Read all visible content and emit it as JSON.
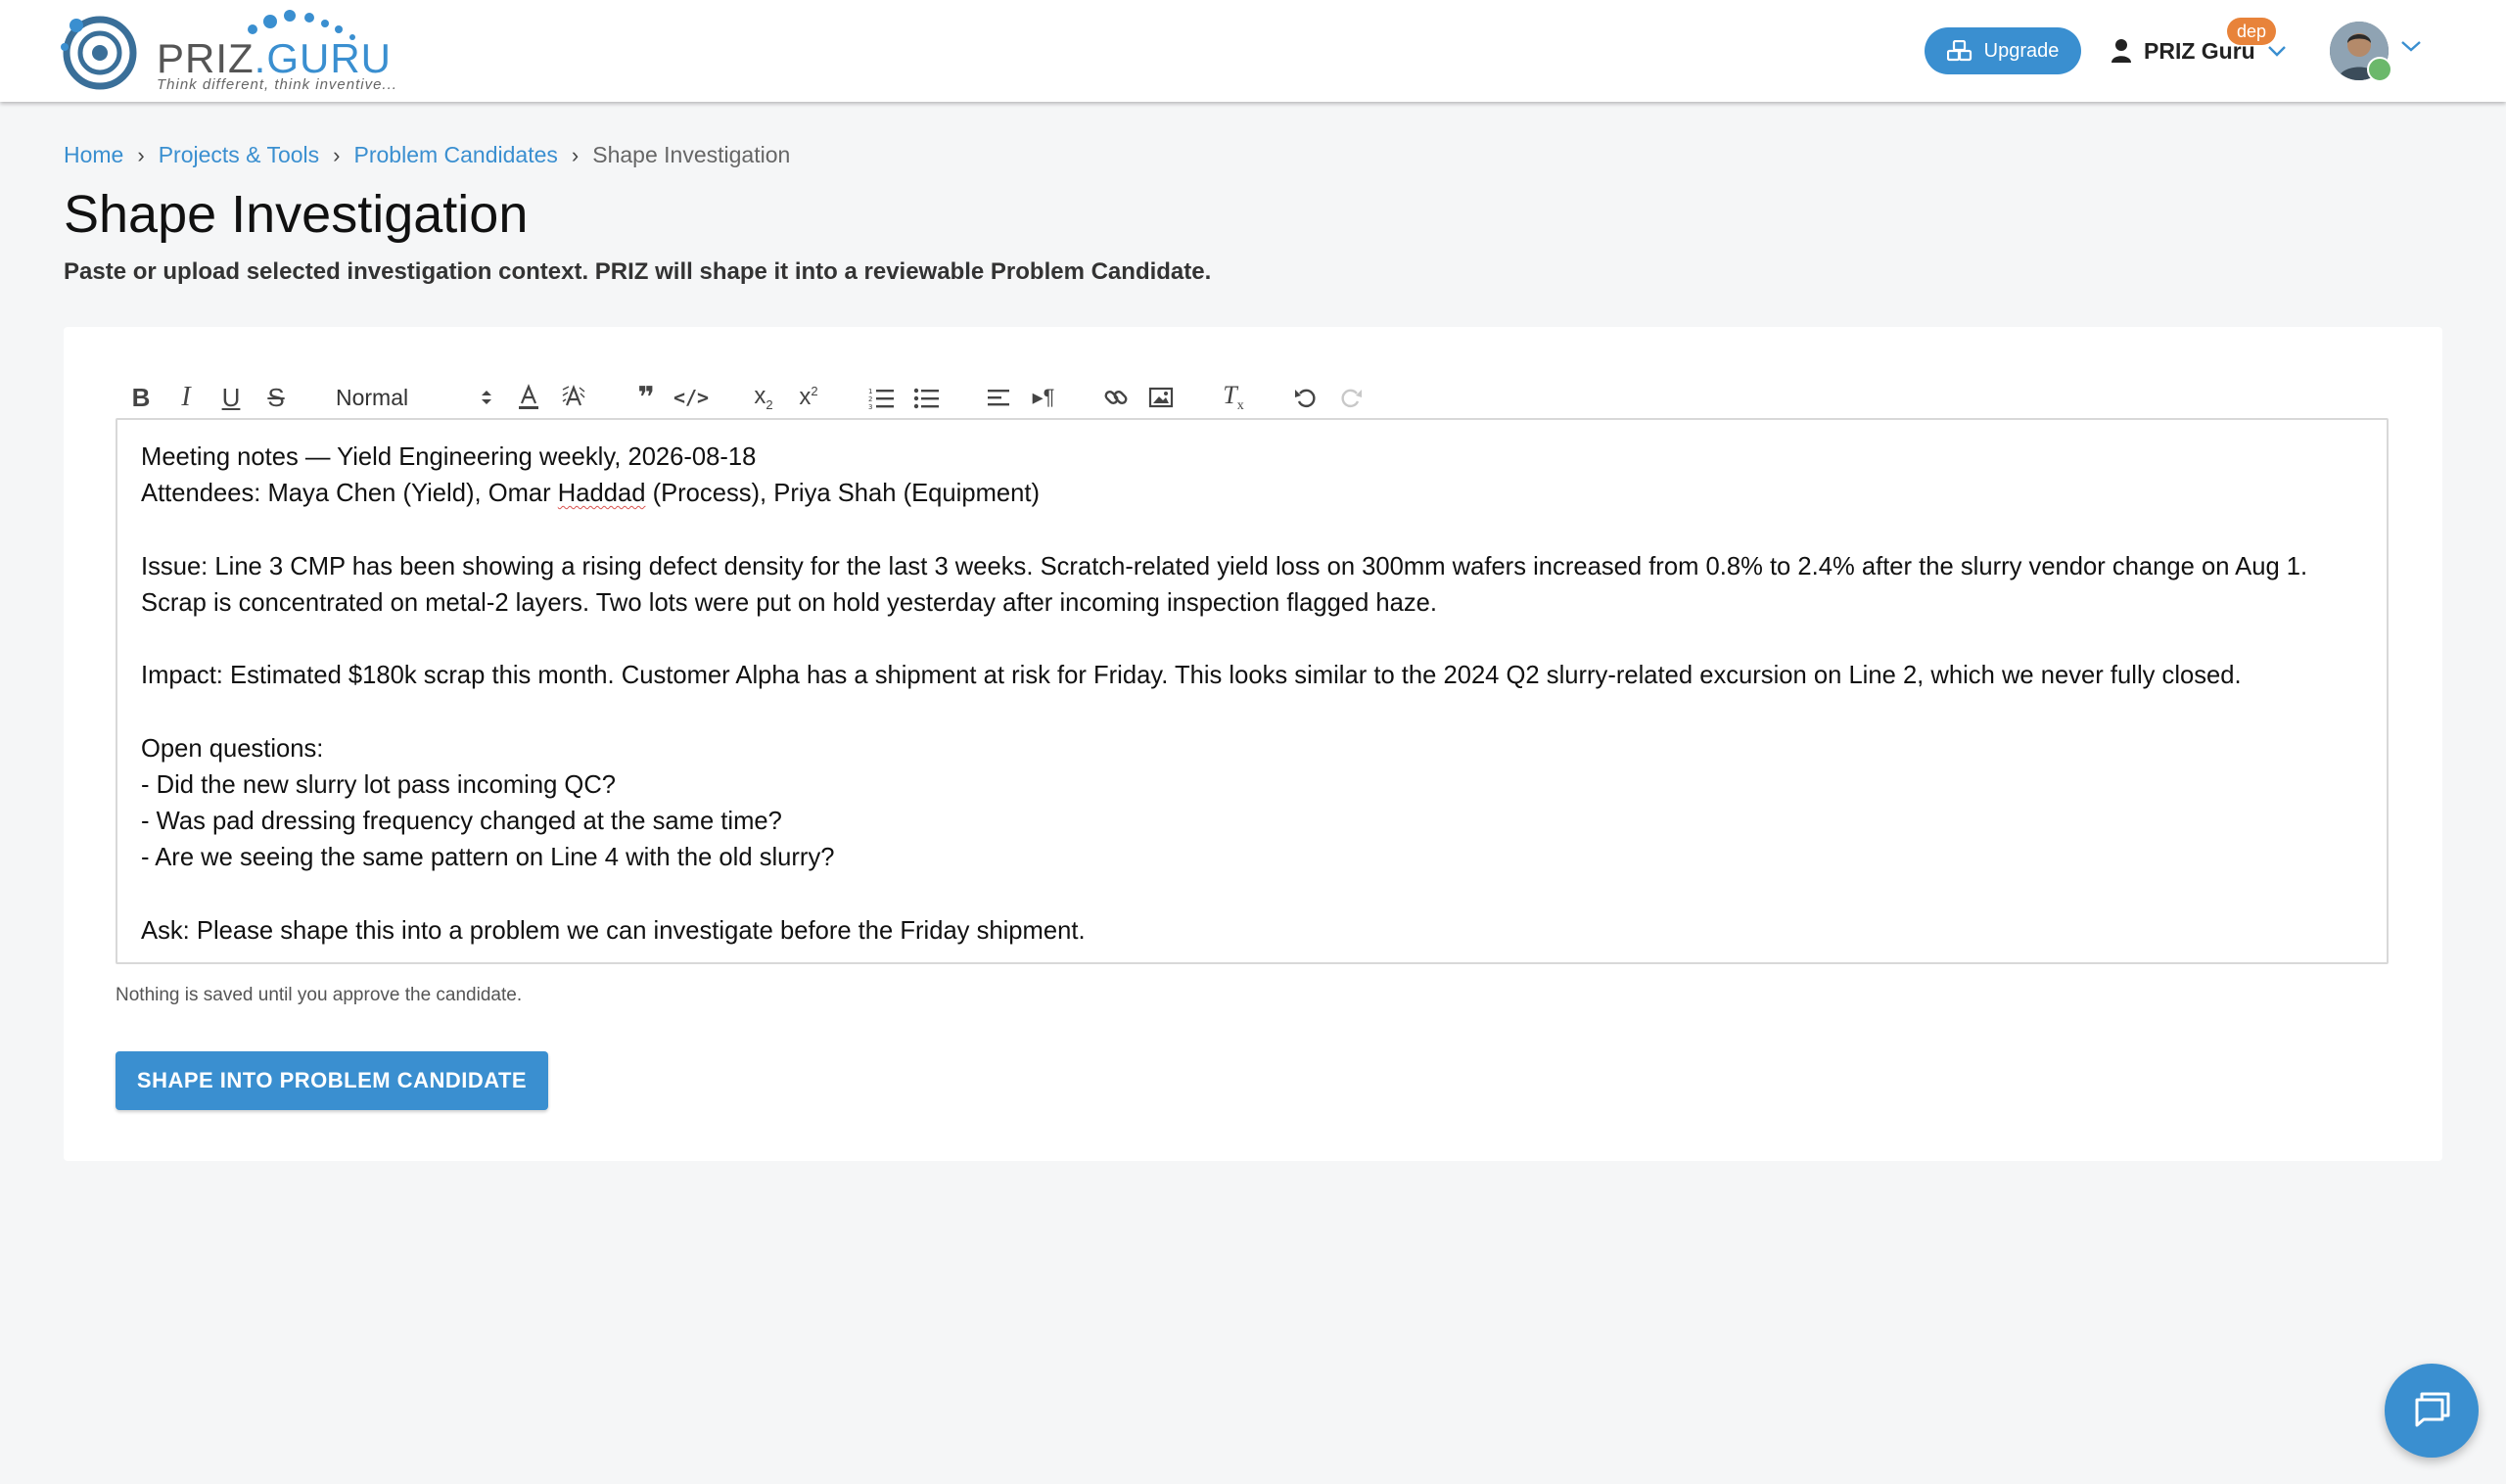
{
  "header": {
    "logo_text_a": "PRIZ",
    "logo_text_b": ".GURU",
    "logo_tagline": "Think different, think inventive...",
    "upgrade_label": "Upgrade",
    "user_name": "PRIZ Guru",
    "env_badge": "dep"
  },
  "breadcrumb": {
    "items": [
      "Home",
      "Projects & Tools",
      "Problem Candidates"
    ],
    "current": "Shape Investigation"
  },
  "page": {
    "title": "Shape Investigation",
    "subtitle": "Paste or upload selected investigation context. PRIZ will shape it into a reviewable Problem Candidate."
  },
  "toolbar": {
    "icons": [
      "bold-icon",
      "italic-icon",
      "underline-icon",
      "strikethrough-icon",
      "text-color-icon",
      "background-color-icon",
      "blockquote-icon",
      "code-block-icon",
      "subscript-icon",
      "superscript-icon",
      "ordered-list-icon",
      "bullet-list-icon",
      "align-icon",
      "text-direction-icon",
      "link-icon",
      "image-icon",
      "clear-format-icon",
      "undo-icon",
      "redo-icon"
    ],
    "heading_select": "Normal"
  },
  "editor": {
    "lines": [
      "Meeting notes — Yield Engineering weekly, 2026-08-18",
      "Attendees: Maya Chen (Yield), Omar Haddad (Process), Priya Shah (Equipment)",
      "",
      "Issue: Line 3 CMP has been showing a rising defect density for the last 3 weeks. Scratch-related yield loss on 300mm wafers increased from 0.8% to 2.4% after the slurry vendor change on Aug 1.",
      "Scrap is concentrated on metal-2 layers. Two lots were put on hold yesterday after incoming inspection flagged haze.",
      "",
      "Impact: Estimated $180k scrap this month. Customer Alpha has a shipment at risk for Friday. This looks similar to the 2024 Q2 slurry-related excursion on Line 2, which we never fully closed.",
      "",
      "Open questions:",
      "- Did the new slurry lot pass incoming QC?",
      "- Was pad dressing frequency changed at the same time?",
      "- Are we seeing the same pattern on Line 4 with the old slurry?",
      "",
      "Ask: Please shape this into a problem we can investigate before the Friday shipment."
    ]
  },
  "hint": "Nothing is saved until you approve the candidate.",
  "actions": {
    "shape_button": "SHAPE INTO PROBLEM CANDIDATE"
  },
  "colors": {
    "accent": "#3a8fd0",
    "badge": "#e8833a",
    "background": "#f5f6f7"
  }
}
